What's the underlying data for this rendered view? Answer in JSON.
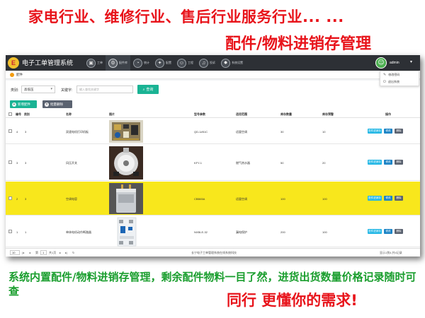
{
  "promo": {
    "headline1": "家电行业、维修行业、售后行业服务行业... ...",
    "headline2": "配件/物料进销存管理",
    "bottom_text": "系统内置配件/物料进销存管理，剩余配件物料一目了然，进货出货数量价格记录随时可查",
    "slogan": "同行 更懂你的需求!"
  },
  "app": {
    "logo_text": "E",
    "title": "电子工单管理系统",
    "nav": [
      {
        "icon": "desktop-icon",
        "glyph": "▣",
        "label": "工单"
      },
      {
        "icon": "parts-icon",
        "glyph": "⚙",
        "label": "配件库"
      },
      {
        "icon": "stats-icon",
        "glyph": "◔",
        "label": "统计"
      },
      {
        "icon": "settings-icon",
        "glyph": "✦",
        "label": "配置"
      },
      {
        "icon": "user-icon",
        "glyph": "☺",
        "label": "工程"
      },
      {
        "icon": "bell-icon",
        "glyph": "♫",
        "label": "投诉"
      },
      {
        "icon": "system-icon",
        "glyph": "✸",
        "label": "系统设置"
      }
    ],
    "user": {
      "name": "admin",
      "caret": "▾"
    },
    "dropdown": [
      {
        "icon": "edit-icon",
        "glyph": "✎",
        "label": "修改密码"
      },
      {
        "icon": "logout-icon",
        "glyph": "⏻",
        "label": "退出系统"
      }
    ]
  },
  "breadcrumb": {
    "label": "配件"
  },
  "search": {
    "category_label": "类别:",
    "category_value": "高低压",
    "category_caret": "▾",
    "keyword_label": "关键字:",
    "keyword_placeholder": "输入查找关键字",
    "search_button": "查询"
  },
  "actions": {
    "add_button": "新增配件",
    "query_button": "批量删除"
  },
  "table": {
    "headers": [
      "编号",
      "类别",
      "名称",
      "图片",
      "型号参数",
      "适用范围",
      "库存数量",
      "库存预警",
      "操作"
    ],
    "rows": [
      {
        "id": "4",
        "category": "3",
        "name": "双速电机打印机板",
        "model": "QD-1#51C",
        "scope": "适量空调",
        "stock": "30",
        "warn": "10",
        "highlight": false
      },
      {
        "id": "3",
        "category": "3",
        "name": "风压开关",
        "model": "KFY-1",
        "scope": "燃气热水器",
        "stock": "50",
        "warn": "20",
        "highlight": false
      },
      {
        "id": "2",
        "category": "3",
        "name": "空调电容",
        "model": "CBB65A",
        "scope": "适量空调",
        "stock": "100",
        "warn": "100",
        "highlight": true
      },
      {
        "id": "1",
        "category": "1",
        "name": "单体电机动作断路器",
        "model": "NXBLE-32",
        "scope": "漏电保护",
        "stock": "200",
        "warn": "100",
        "highlight": false
      }
    ],
    "row_buttons": {
      "record": "配件进销存",
      "edit": "修改",
      "delete": "删除"
    }
  },
  "pager": {
    "page_size": "10",
    "first": "|◂",
    "prev": "◂",
    "page_label": "第",
    "page_value": "1",
    "total_pages": "共1页",
    "next": "▸",
    "last": "▸|",
    "refresh": "↻",
    "summary": "显示1到4,共4记录",
    "footer": "长宁电子工单管理系统在线系统科技"
  },
  "colors": {
    "promo_red": "#e8141b",
    "promo_green": "#1a9e2e",
    "topbar": "#2d3035",
    "search_green": "#1ab394",
    "row_highlight": "#f8e71c",
    "btn_teal": "#23b7e5",
    "btn_blue": "#1c84c6",
    "btn_gray": "#5a6270"
  }
}
